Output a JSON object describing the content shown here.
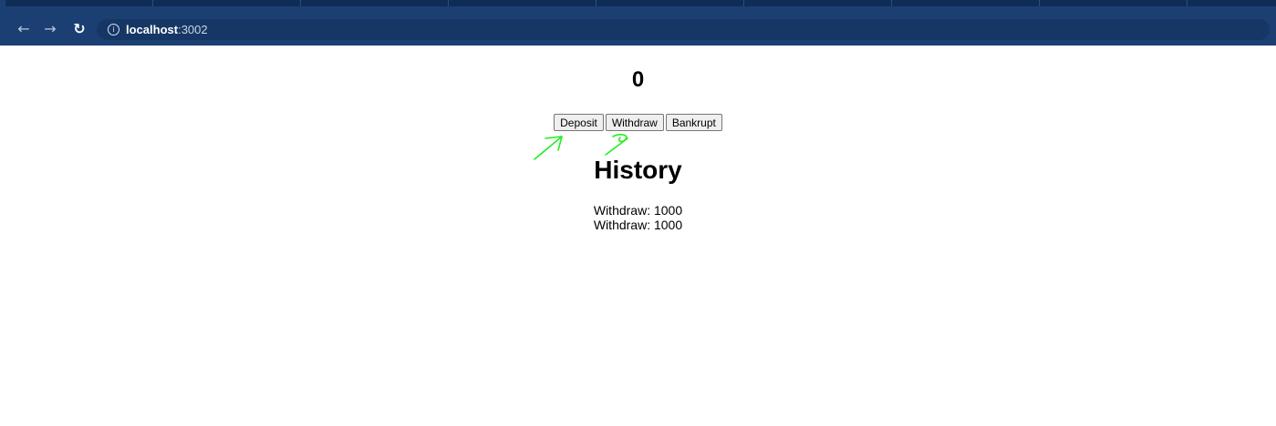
{
  "browser": {
    "url_host": "localhost",
    "url_port": ":3002",
    "icons": {
      "back": "arrow-left-icon",
      "forward": "arrow-right-icon",
      "reload": "reload-icon",
      "info": "info-icon"
    }
  },
  "app": {
    "balance": "0",
    "buttons": {
      "deposit": "Deposit",
      "withdraw": "Withdraw",
      "bankrupt": "Bankrupt"
    },
    "history_title": "History",
    "history": [
      "Withdraw: 1000",
      "Withdraw: 1000"
    ]
  },
  "colors": {
    "chrome": "#1c3f73",
    "annotation": "#22ee22"
  }
}
